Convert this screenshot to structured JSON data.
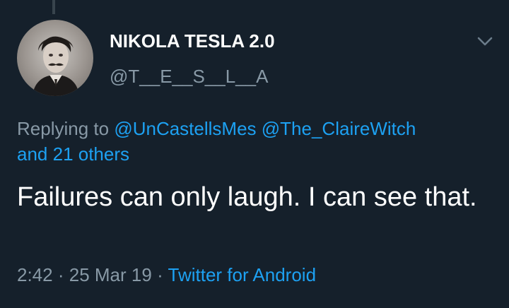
{
  "tweet": {
    "display_name": "NIKOLA TESLA 2.0",
    "handle": "@T__E__S__L__A",
    "reply_prefix": "Replying to",
    "reply_mentions": [
      "@UnCastellsMes",
      "@The_ClaireWitch"
    ],
    "reply_others": "and 21 others",
    "text": "Failures can only laugh. I can see that.",
    "time": "2:42",
    "separator": "·",
    "date": "25 Mar 19",
    "source": "Twitter for Android"
  },
  "icons": {
    "menu": "chevron-down-icon",
    "avatar": "profile-photo"
  },
  "colors": {
    "background": "#15202b",
    "text_primary": "#ffffff",
    "text_secondary": "#8899a6",
    "accent": "#1da1f2"
  }
}
